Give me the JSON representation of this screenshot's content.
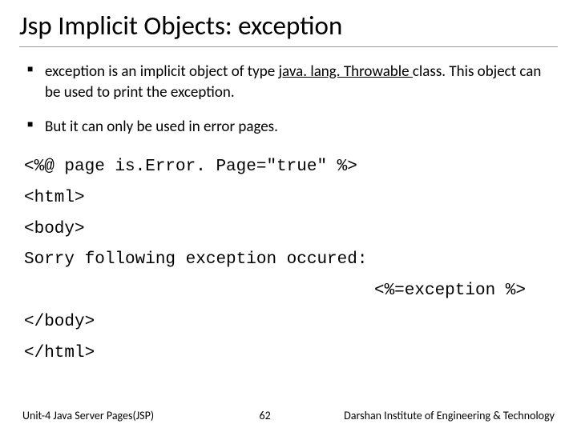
{
  "title": "Jsp Implicit Objects: exception",
  "bullets": [
    {
      "pre": "exception is an implicit object of type ",
      "underlined": "java. lang. Throwable ",
      "post": "class. This object can be used to print the exception."
    },
    {
      "pre": "But it can only be used in error pages.",
      "underlined": "",
      "post": ""
    }
  ],
  "code": {
    "l1": "<%@ page is.Error. Page=\"true\" %>",
    "l2": "<html>",
    "l3": "<body>",
    "l4": "Sorry following exception occured:",
    "l5": "<%=exception %>",
    "l6": "</body>",
    "l7": "</html>"
  },
  "footer": {
    "unit": "Unit-4 Java Server Pages(JSP)",
    "page": "62",
    "institute": "Darshan Institute of Engineering & Technology"
  }
}
